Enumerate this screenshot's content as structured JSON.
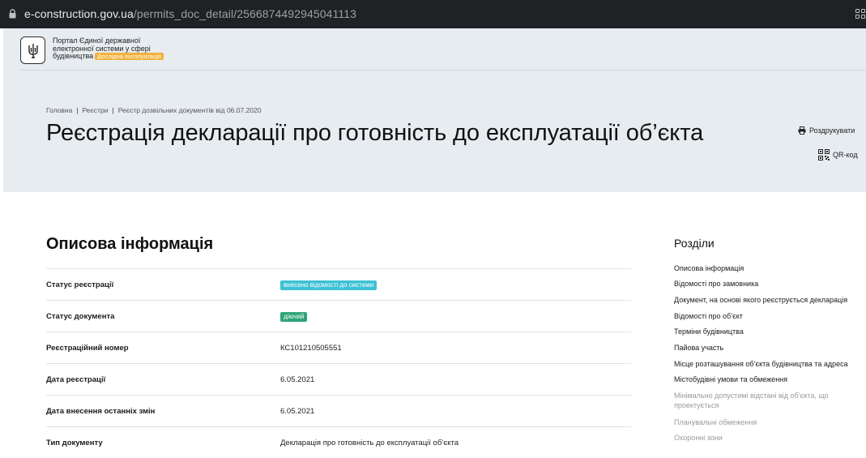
{
  "browser": {
    "url_domain": "e-construction.gov.ua",
    "url_path": "/permits_doc_detail/2566874492945041113"
  },
  "header": {
    "portal_line1": "Портал Єдиної державної",
    "portal_line2": "електронної системи у сфері",
    "portal_line3": "будівництва",
    "badge": "Дослідна експлуатація",
    "badge_color": "#f2b13a"
  },
  "breadcrumb": [
    "Головна",
    "Реєстри",
    "Реєстр дозвільних документів від 06.07.2020"
  ],
  "page": {
    "title": "Реєстрація декларації про готовність до експлуатації об’єкта",
    "print_label": "Роздрукувати",
    "qr_label": "QR-код"
  },
  "main": {
    "section_title": "Описова інформація",
    "rows": [
      {
        "key": "Статус реєстрації",
        "value": "внесено відомості до системи",
        "pill_color": "#3ec1d6"
      },
      {
        "key": "Статус документа",
        "value": "діючий",
        "pill_color": "#2fa577"
      },
      {
        "key": "Реєстраційний номер",
        "value": "КС101210505551"
      },
      {
        "key": "Дата реєстрації",
        "value": "6.05.2021"
      },
      {
        "key": "Дата внесення останніх змін",
        "value": "6.05.2021"
      },
      {
        "key": "Тип документу",
        "value": "Декларація про готовність до експлуатації об’єкта"
      }
    ]
  },
  "sidebar": {
    "title": "Розділи",
    "items": [
      "Описова інформація",
      "Відомості про замовника",
      "Документ, на основі якого реєструється декларація",
      "Відомості про об’єкт",
      "Терміни будівництва",
      "Пайова участь",
      "Місце розташування об’єкта будівництва та адреса",
      "Містобудівні умови та обмеження",
      "Мінімально допустимі відстані від об’єкта, що",
      "проектується",
      "Планувальні обмеження",
      "Охоронні зони"
    ]
  }
}
